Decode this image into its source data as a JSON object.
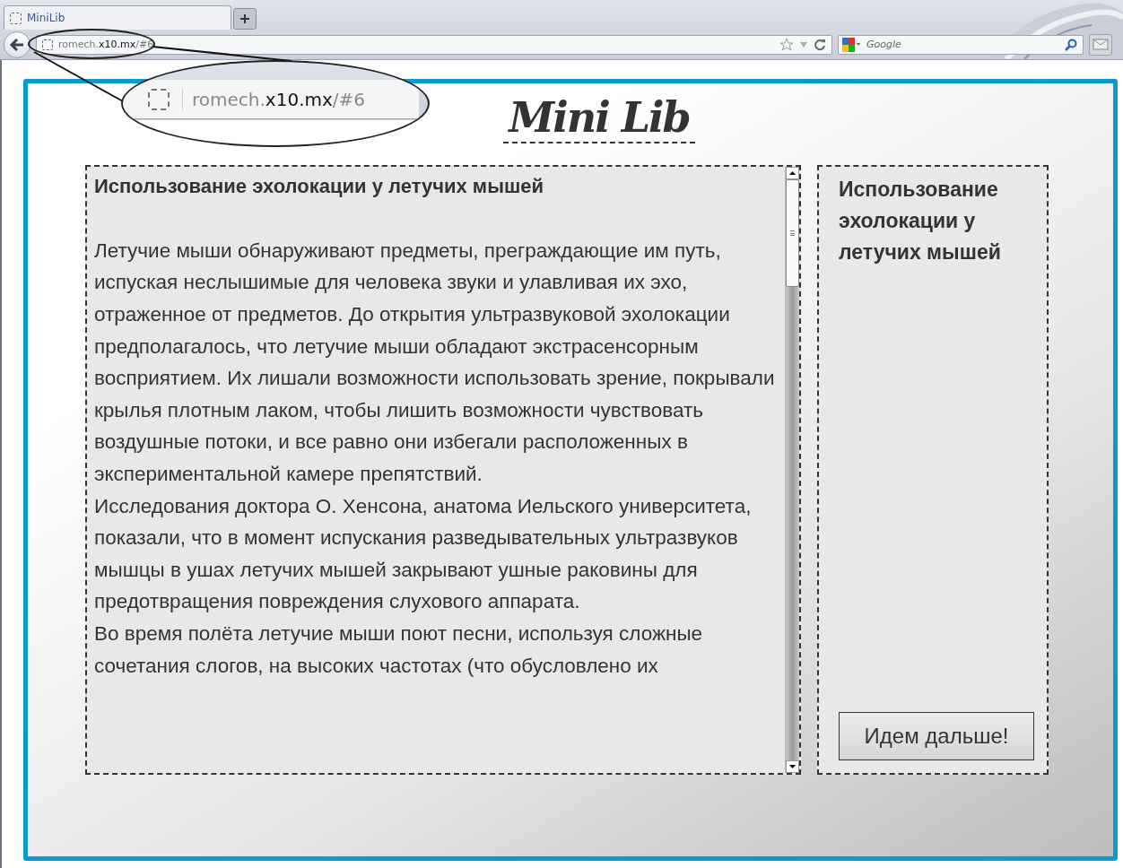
{
  "browser": {
    "tab": {
      "title": "MiniLib",
      "selected": true
    },
    "address": "romech.**x10.mx**/#6",
    "search": {
      "placeholder": "Google"
    }
  },
  "callout": {
    "address": "romech.**x10.mx**/#6"
  },
  "page": {
    "logo": "Mini Lib",
    "article": {
      "title": "Использование эхолокации у летучих мышей",
      "paragraphs": [
        "Летучие мыши обнаруживают предметы, преграждающие им путь, испуская неслышимые для человека звуки и улавливая их эхо, отраженное от предметов. До открытия ультразвуковой эхолокации предполагалось, что летучие мыши обладают экстрасенсорным восприятием. Их лишали возможности использовать зрение, покрывали крылья плотным лаком, чтобы лишить возможности чувствовать воздушные потоки, и все равно они избегали расположенных в экспериментальной камере препятствий.",
        "Исследования доктора О. Хенсона, анатома Иельского университета, показали, что в момент испускания разведывательных ультразвуков мышцы в ушах летучих мышей закрывают ушные раковины для предотвращения повреждения слухового аппарата.",
        "Во время полёта летучие мыши поют песни, используя сложные сочетания слогов, на высоких частотах (что обусловлено их"
      ]
    },
    "sidebar": {
      "title": "Использование эхолокации у летучих мышей",
      "button": "Идем дальше!"
    }
  }
}
